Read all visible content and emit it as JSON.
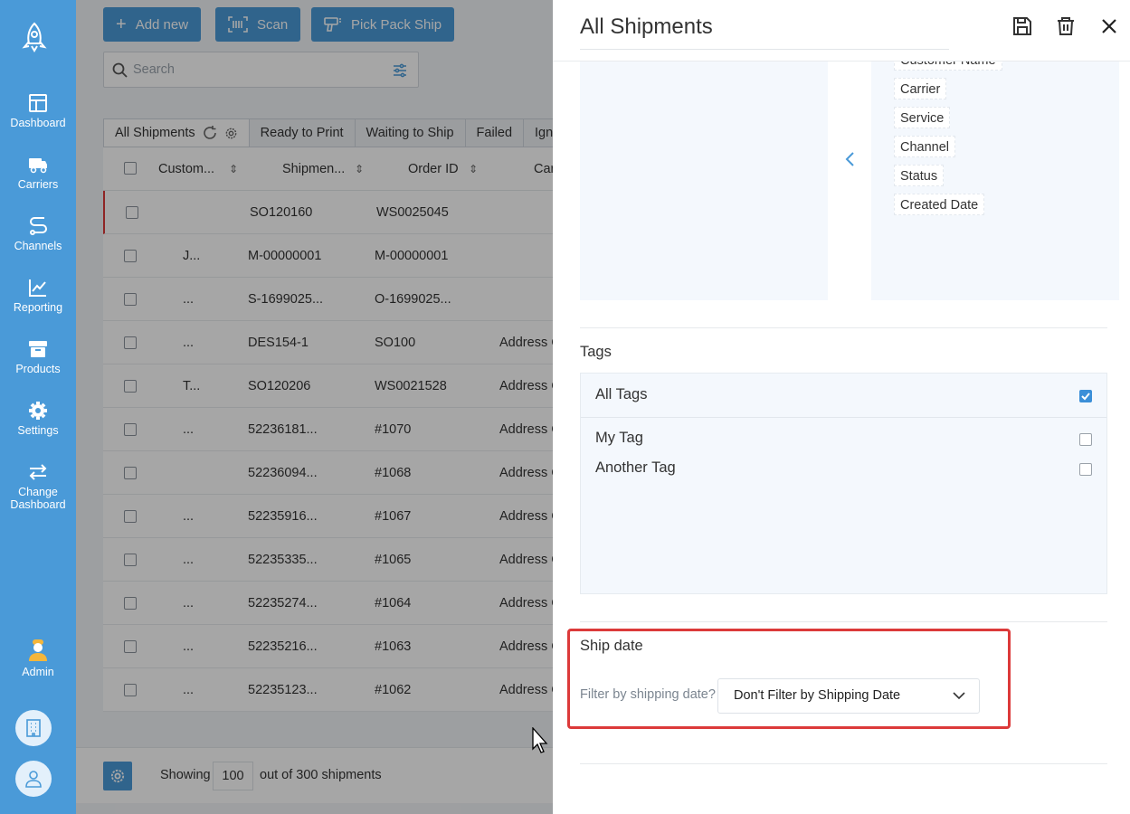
{
  "nav": {
    "items": [
      {
        "label": "Dashboard",
        "icon": "dashboard-icon"
      },
      {
        "label": "Carriers",
        "icon": "truck-icon"
      },
      {
        "label": "Channels",
        "icon": "route-icon"
      },
      {
        "label": "Reporting",
        "icon": "chart-icon"
      },
      {
        "label": "Products",
        "icon": "box-icon"
      },
      {
        "label": "Settings",
        "icon": "gear-icon"
      },
      {
        "label": "Change Dashboard",
        "icon": "swap-icon"
      }
    ],
    "admin_label": "Admin"
  },
  "toolbar": {
    "add_new": "Add new",
    "scan": "Scan",
    "pick_pack_ship": "Pick Pack Ship",
    "search_placeholder": "Search"
  },
  "tabs": [
    "All Shipments",
    "Ready to Print",
    "Waiting to Ship",
    "Failed",
    "Ignor"
  ],
  "table": {
    "headers": [
      "Custom...",
      "Shipmen...",
      "Order ID",
      "Car"
    ],
    "rows": [
      {
        "customer": "",
        "shipment": "SO120160",
        "order": "WS0025045",
        "carrier": ""
      },
      {
        "customer": "J...",
        "shipment": "M-00000001",
        "order": "M-00000001",
        "carrier": ""
      },
      {
        "customer": "...",
        "shipment": "S-1699025...",
        "order": "O-1699025...",
        "carrier": ""
      },
      {
        "customer": "...",
        "shipment": "DES154-1",
        "order": "SO100",
        "carrier": "Address C"
      },
      {
        "customer": "T...",
        "shipment": "SO120206",
        "order": "WS0021528",
        "carrier": "Address C"
      },
      {
        "customer": "...",
        "shipment": "52236181...",
        "order": "#1070",
        "carrier": "Address C"
      },
      {
        "customer": "",
        "shipment": "52236094...",
        "order": "#1068",
        "carrier": "Address C"
      },
      {
        "customer": "...",
        "shipment": "52235916...",
        "order": "#1067",
        "carrier": "Address C"
      },
      {
        "customer": "...",
        "shipment": "52235335...",
        "order": "#1065",
        "carrier": "Address C"
      },
      {
        "customer": "...",
        "shipment": "52235274...",
        "order": "#1064",
        "carrier": "Address C"
      },
      {
        "customer": "...",
        "shipment": "52235216...",
        "order": "#1063",
        "carrier": "Address C"
      },
      {
        "customer": "...",
        "shipment": "52235123...",
        "order": "#1062",
        "carrier": "Address C"
      }
    ]
  },
  "footer": {
    "showing": "Showing",
    "count": "100",
    "suffix": "out of 300 shipments"
  },
  "panel": {
    "title": "All Shipments",
    "columns": [
      "Customer Name",
      "Carrier",
      "Service",
      "Channel",
      "Status",
      "Created Date"
    ],
    "tags_title": "Tags",
    "tags": [
      {
        "label": "All Tags",
        "checked": true
      },
      {
        "label": "My Tag",
        "checked": false
      },
      {
        "label": "Another Tag",
        "checked": false
      }
    ],
    "ship_date_title": "Ship date",
    "filter_label": "Filter by shipping date?",
    "filter_value": "Don't Filter by Shipping Date"
  },
  "colors": {
    "accent": "#4a9ad8",
    "highlight": "#dc3a3a"
  }
}
